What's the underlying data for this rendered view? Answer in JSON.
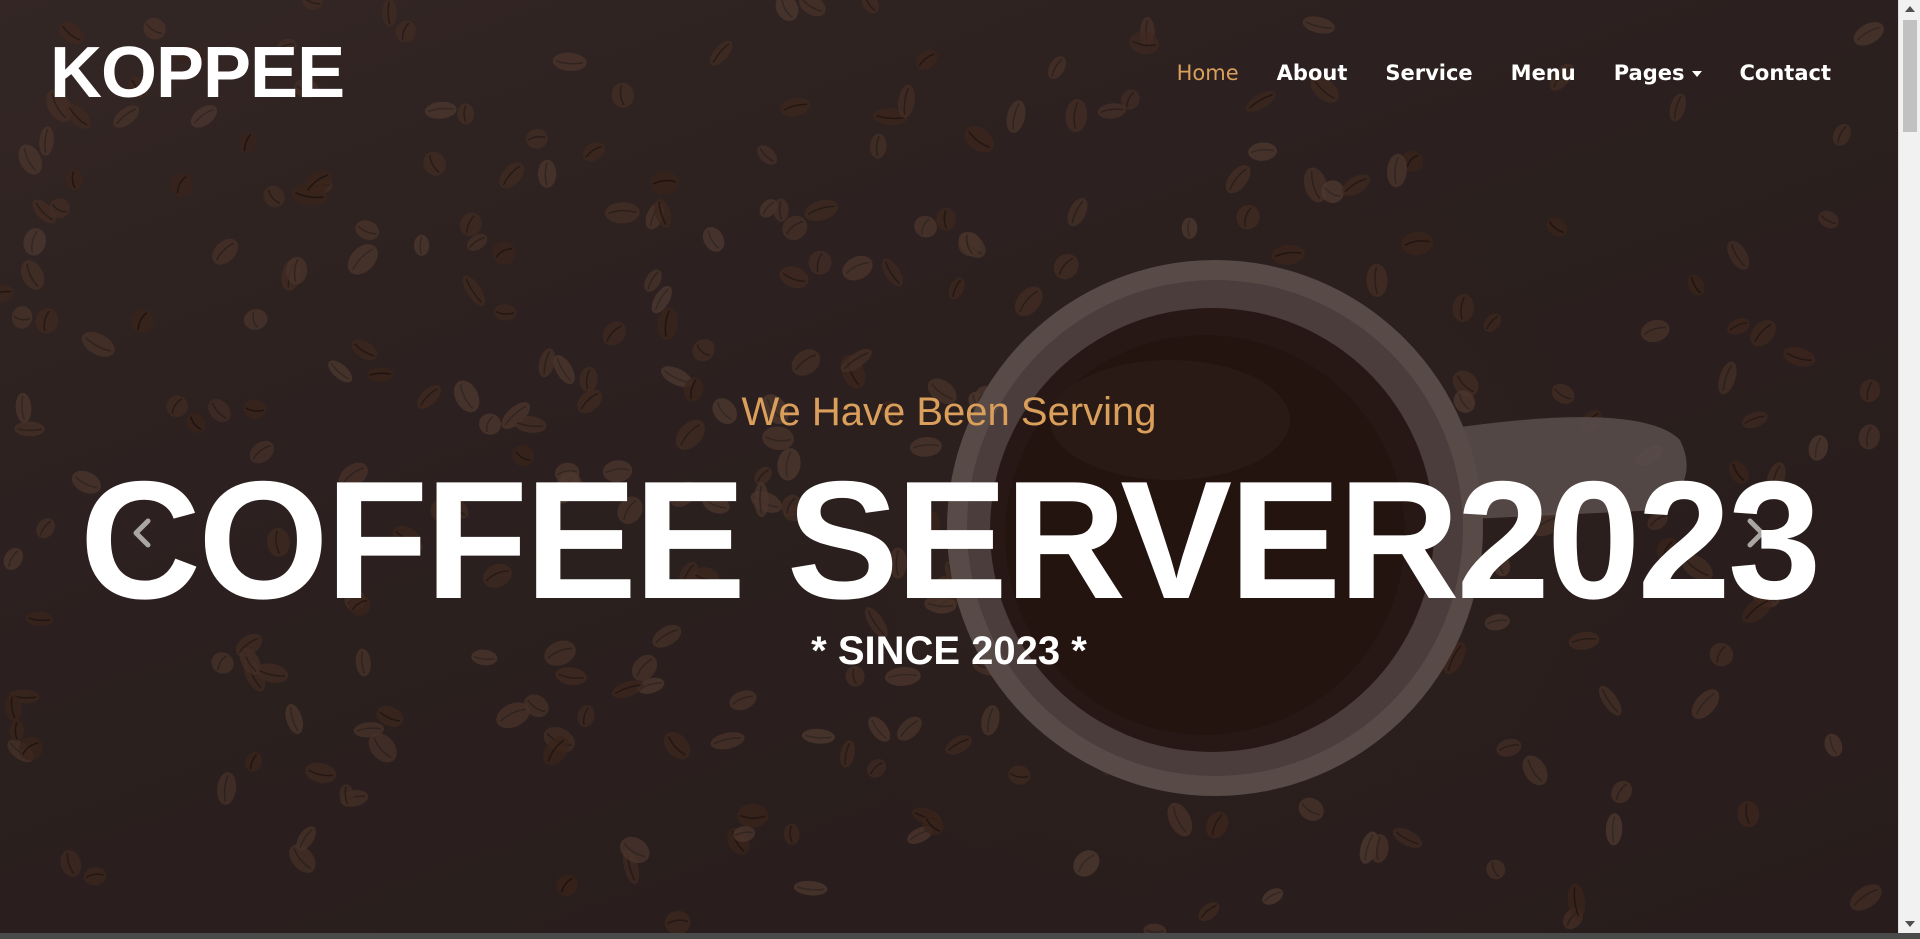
{
  "brand": {
    "name": "KOPPEE"
  },
  "nav": {
    "items": [
      {
        "label": "Home",
        "active": true
      },
      {
        "label": "About",
        "active": false
      },
      {
        "label": "Service",
        "active": false
      },
      {
        "label": "Menu",
        "active": false
      },
      {
        "label": "Pages",
        "active": false,
        "dropdown": true
      },
      {
        "label": "Contact",
        "active": false
      }
    ]
  },
  "hero": {
    "subtitle": "We Have Been Serving",
    "headline": "COFFEE SERVER2023",
    "since": "* SINCE 2023 *",
    "prev_icon": "chevron-left-icon",
    "next_icon": "chevron-right-icon"
  },
  "colors": {
    "accent": "#da9f5b",
    "text": "#ffffff",
    "background": "#2f2423"
  }
}
